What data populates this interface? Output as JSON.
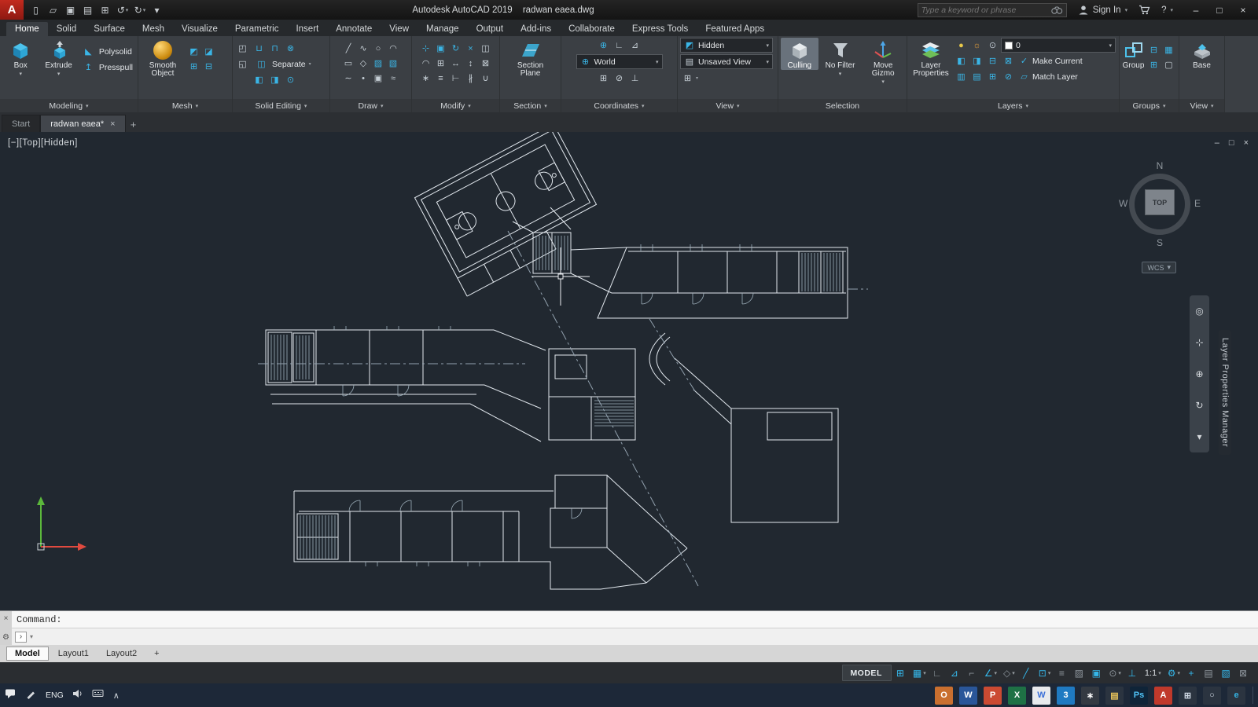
{
  "glyphs": {
    "caret": "▾"
  },
  "titlebar": {
    "logo_letter": "A",
    "app_title": "Autodesk AutoCAD 2019",
    "doc_title": "radwan eaea.dwg",
    "search_placeholder": "Type a keyword or phrase",
    "sign_in_label": "Sign In",
    "help_label": "?",
    "qat": [
      {
        "name": "new-file-icon",
        "text": "▯"
      },
      {
        "name": "open-file-icon",
        "text": "▱"
      },
      {
        "name": "save-icon",
        "text": "▣"
      },
      {
        "name": "save-as-icon",
        "text": "▤"
      },
      {
        "name": "plot-icon",
        "text": "⊞"
      },
      {
        "name": "undo-icon",
        "text": "↺",
        "caret": "▾"
      },
      {
        "name": "redo-icon",
        "text": "↻",
        "caret": "▾"
      },
      {
        "name": "qat-menu-icon",
        "text": "▾"
      }
    ],
    "window_buttons": {
      "minimize": "–",
      "maximize": "□",
      "close": "×"
    }
  },
  "ribbon_tabs": [
    {
      "name": "tab-home",
      "label": "Home",
      "active": true
    },
    {
      "name": "tab-solid",
      "label": "Solid"
    },
    {
      "name": "tab-surface",
      "label": "Surface"
    },
    {
      "name": "tab-mesh",
      "label": "Mesh"
    },
    {
      "name": "tab-visualize",
      "label": "Visualize"
    },
    {
      "name": "tab-parametric",
      "label": "Parametric"
    },
    {
      "name": "tab-insert",
      "label": "Insert"
    },
    {
      "name": "tab-annotate",
      "label": "Annotate"
    },
    {
      "name": "tab-view",
      "label": "View"
    },
    {
      "name": "tab-manage",
      "label": "Manage"
    },
    {
      "name": "tab-output",
      "label": "Output"
    },
    {
      "name": "tab-addins",
      "label": "Add-ins"
    },
    {
      "name": "tab-collaborate",
      "label": "Collaborate"
    },
    {
      "name": "tab-express-tools",
      "label": "Express Tools"
    },
    {
      "name": "tab-featured-apps",
      "label": "Featured Apps"
    }
  ],
  "ribbon_options_icon": "▭",
  "panels": {
    "modeling": {
      "label": "Modeling",
      "caret": "▾",
      "box": "Box",
      "extrude": "Extrude",
      "polysolid": "Polysolid",
      "presspull": "Presspull",
      "polysolid_icon": "◣",
      "presspull_icon": "↥"
    },
    "mesh": {
      "label": "Mesh",
      "caret": "▾",
      "smooth": "Smooth Object",
      "icons": [
        {
          "name": "mesh-revolve-icon",
          "text": "◩",
          "t": true
        },
        {
          "name": "mesh-edge-icon",
          "text": "◪",
          "t": true,
          "caret": "▾"
        },
        {
          "name": "mesh-refine-icon",
          "text": "⊞",
          "t": true
        },
        {
          "name": "mesh-crease-icon",
          "text": "⊟",
          "t": true,
          "caret": "▾"
        }
      ]
    },
    "solid_editing": {
      "label": "Solid Editing",
      "caret": "▾",
      "separate": "Separate",
      "left_icons": [
        {
          "name": "solid-history-icon",
          "text": "◰",
          "caret": "▾"
        },
        {
          "name": "solid-shell-icon",
          "text": "◱",
          "caret": "▾"
        }
      ],
      "row1": [
        {
          "name": "union-icon",
          "text": "⊔",
          "t": true
        },
        {
          "name": "subtract-icon",
          "text": "⊓",
          "t": true
        },
        {
          "name": "intersect-icon",
          "text": "⊗",
          "t": true
        }
      ],
      "separate_icon": "◫",
      "row3": [
        {
          "name": "fillet-edge-icon",
          "text": "◧",
          "t": true,
          "caret": "▾"
        },
        {
          "name": "taper-faces-icon",
          "text": "◨",
          "t": true,
          "caret": "▾"
        },
        {
          "name": "extract-edges-icon",
          "text": "⊙",
          "t": true
        }
      ]
    },
    "draw": {
      "label": "Draw",
      "caret": "▾",
      "icons": [
        {
          "name": "line-icon",
          "text": "╱"
        },
        {
          "name": "polyline-icon",
          "text": "∿"
        },
        {
          "name": "circle-icon",
          "text": "○",
          "caret": "▾"
        },
        {
          "name": "arc-icon",
          "text": "◠",
          "caret": "▾"
        },
        {
          "name": "rectangle-icon",
          "text": "▭",
          "caret": "▾"
        },
        {
          "name": "polygon-icon",
          "text": "◇"
        },
        {
          "name": "hatch-icon",
          "text": "▨",
          "t": true
        },
        {
          "name": "gradient-icon",
          "text": "▧",
          "t": true
        },
        {
          "name": "spline-icon",
          "text": "∼"
        },
        {
          "name": "point-icon",
          "text": "•"
        },
        {
          "name": "region-icon",
          "text": "▣"
        },
        {
          "name": "revision-cloud-icon",
          "text": "≈"
        }
      ]
    },
    "modify": {
      "label": "Modify",
      "caret": "▾",
      "icons": [
        {
          "name": "move-icon",
          "text": "⊹",
          "t": true
        },
        {
          "name": "copy-icon",
          "text": "▣",
          "t": true
        },
        {
          "name": "rotate-icon",
          "text": "↻",
          "t": true
        },
        {
          "name": "trim-icon",
          "text": "×",
          "t": true
        },
        {
          "name": "mirror-icon",
          "text": "◫"
        },
        {
          "name": "fillet-icon",
          "text": "◠",
          "caret": "▾"
        },
        {
          "name": "array-icon",
          "text": "⊞",
          "caret": "▾"
        },
        {
          "name": "stretch-icon",
          "text": "↔"
        },
        {
          "name": "scale-icon",
          "text": "↕"
        },
        {
          "name": "erase-icon",
          "text": "⊠"
        },
        {
          "name": "explode-icon",
          "text": "∗"
        },
        {
          "name": "offset-icon",
          "text": "≡"
        },
        {
          "name": "extend-icon",
          "text": "⊢"
        },
        {
          "name": "break-icon",
          "text": "∦"
        },
        {
          "name": "join-icon",
          "text": "∪"
        }
      ]
    },
    "section": {
      "label": "Section",
      "caret": "▾",
      "plane": "Section Plane"
    },
    "coordinates": {
      "label": "Coordinates",
      "caret": "▾",
      "world": "World",
      "world_icon": "⊕",
      "row1": [
        {
          "name": "ucs-icon",
          "text": "⊕",
          "t": true,
          "caret": "▾"
        },
        {
          "name": "ucs-previous-icon",
          "text": "∟"
        },
        {
          "name": "ucs-face-icon",
          "text": "⊿"
        }
      ],
      "row3": [
        {
          "name": "ucs-origin-icon",
          "text": "⊞"
        },
        {
          "name": "ucs-z-axis-icon",
          "text": "⊘"
        },
        {
          "name": "ucs-view-icon",
          "text": "⊥"
        }
      ]
    },
    "view_styles": {
      "label": "View",
      "caret": "▾",
      "visual_style": "Hidden",
      "visual_style_icon": "◩",
      "named_view": "Unsaved View",
      "named_view_icon": "▤",
      "viewport_icon": "⊞"
    },
    "selection": {
      "label": "Selection",
      "culling": "Culling",
      "no_filter": "No Filter",
      "move_gizmo": "Move Gizmo"
    },
    "layers": {
      "label": "Layers",
      "caret": "▾",
      "properties": "Layer Properties",
      "make_current": "Make Current",
      "match_layer": "Match Layer",
      "current_layer": "0",
      "make_current_icon": "✓",
      "match_layer_icon": "▱",
      "state_icons": [
        {
          "name": "layer-on-icon",
          "text": "●",
          "fg": "#e8c84a"
        },
        {
          "name": "layer-freeze-icon",
          "text": "☼",
          "fg": "#e8a23c"
        },
        {
          "name": "layer-lock-icon",
          "text": "⊙",
          "fg": "#b9c2cb"
        }
      ],
      "row2_icons": [
        {
          "name": "layer-isolate-icon",
          "text": "◧",
          "t": true
        },
        {
          "name": "layer-unisolate-icon",
          "text": "◨",
          "t": true
        },
        {
          "name": "layer-freeze-pick-icon",
          "text": "⊟",
          "t": true
        },
        {
          "name": "layer-off-pick-icon",
          "text": "⊠",
          "t": true
        }
      ],
      "row3_icons": [
        {
          "name": "layer-walk-icon",
          "text": "▥",
          "t": true
        },
        {
          "name": "layer-states-icon",
          "text": "▤",
          "t": true
        },
        {
          "name": "layer-merge-icon",
          "text": "⊞",
          "t": true
        },
        {
          "name": "layer-delete-icon",
          "text": "⊘",
          "t": true
        }
      ]
    },
    "groups": {
      "label": "Groups",
      "caret": "▾",
      "group": "Group",
      "icons": [
        {
          "name": "ungroup-icon",
          "text": "⊟",
          "t": true
        },
        {
          "name": "group-edit-icon",
          "text": "▦",
          "t": true
        },
        {
          "name": "group-selection-icon",
          "text": "⊞",
          "t": true
        },
        {
          "name": "group-bbox-icon",
          "text": "▢"
        }
      ]
    },
    "view_create": {
      "label": "View",
      "caret": "▾",
      "base": "Base"
    }
  },
  "file_tabs": {
    "start": "Start",
    "drawing": "radwan eaea*",
    "close_icon": "×",
    "new_tab": "+"
  },
  "viewport": {
    "controls": {
      "minimize": "[−]",
      "view": "[Top]",
      "visual_style": "[Hidden]"
    },
    "window_buttons": {
      "minimize": "–",
      "restore": "□",
      "close": "×"
    },
    "viewcube": {
      "n": "N",
      "e": "E",
      "s": "S",
      "w": "W",
      "face": "TOP",
      "wcs": "WCS",
      "wcs_caret": "▾"
    },
    "navbar_icons": [
      {
        "name": "steering-wheel-icon",
        "text": "◎"
      },
      {
        "name": "pan-icon",
        "text": "⊹"
      },
      {
        "name": "zoom-icon",
        "text": "⊕"
      },
      {
        "name": "orbit-icon",
        "text": "↻"
      },
      {
        "name": "navbar-more-icon",
        "text": "▾"
      }
    ],
    "palette_title": "Layer Properties Manager"
  },
  "command": {
    "prompt": "Command:",
    "close_icon": "×",
    "customize_icon": "⚙",
    "recent_icon": "›",
    "caret_icon": "▾"
  },
  "layout_tabs": [
    {
      "name": "layout-tab-model",
      "label": "Model",
      "active": true
    },
    {
      "name": "layout-tab-layout1",
      "label": "Layout1"
    },
    {
      "name": "layout-tab-layout2",
      "label": "Layout2"
    },
    {
      "name": "new-layout-button",
      "label": "+"
    }
  ],
  "statusbar": [
    {
      "name": "model-space-toggle",
      "text": "MODEL",
      "wide": true
    },
    {
      "name": "grid-display-icon",
      "text": "⊞",
      "on": true
    },
    {
      "name": "snap-mode-icon",
      "text": "▦",
      "on": true,
      "caret": "▾"
    },
    {
      "name": "infer-constraints-icon",
      "text": "∟"
    },
    {
      "name": "dynamic-input-icon",
      "text": "⊿",
      "on": true
    },
    {
      "name": "ortho-mode-icon",
      "text": "⌐"
    },
    {
      "name": "polar-tracking-icon",
      "text": "∠",
      "on": true,
      "caret": "▾"
    },
    {
      "name": "isometric-drafting-icon",
      "text": "◇",
      "caret": "▾"
    },
    {
      "name": "osnap-tracking-icon",
      "text": "╱",
      "on": true
    },
    {
      "name": "object-snap-icon",
      "text": "⊡",
      "on": true,
      "caret": "▾"
    },
    {
      "name": "lineweight-icon",
      "text": "≡"
    },
    {
      "name": "transparency-icon",
      "text": "▨"
    },
    {
      "name": "selection-cycling-icon",
      "text": "▣",
      "on": true
    },
    {
      "name": "3d-object-snap-icon",
      "text": "⊙",
      "caret": "▾"
    },
    {
      "name": "dynamic-ucs-icon",
      "text": "⊥",
      "on": true
    },
    {
      "name": "annotation-scale",
      "text": "1:1",
      "caret": "▾"
    },
    {
      "name": "workspace-switching-icon",
      "text": "⚙",
      "on": true,
      "caret": "▾"
    },
    {
      "name": "annotation-monitor-icon",
      "text": "+",
      "on": true
    },
    {
      "name": "quick-properties-icon",
      "text": "▤"
    },
    {
      "name": "graphics-performance-icon",
      "text": "▧",
      "on": true
    },
    {
      "name": "clean-screen-icon",
      "text": "⊠"
    }
  ],
  "taskbar": {
    "language": "ENG",
    "chevron": "∧",
    "apps": [
      {
        "name": "taskbar-outlook",
        "text": "O",
        "bg": "#c96f2f"
      },
      {
        "name": "taskbar-word",
        "text": "W",
        "bg": "#2a5699"
      },
      {
        "name": "taskbar-powerpoint",
        "text": "P",
        "bg": "#cb4a32"
      },
      {
        "name": "taskbar-excel",
        "text": "X",
        "bg": "#1e7145"
      },
      {
        "name": "taskbar-wps",
        "text": "W",
        "bg": "#e8eaed",
        "fg": "#3a6fd8"
      },
      {
        "name": "taskbar-3dsmax",
        "text": "3",
        "bg": "#1f7ac2"
      },
      {
        "name": "taskbar-snip",
        "text": "∗",
        "bg": "#343a42"
      },
      {
        "name": "taskbar-explorer",
        "text": "▤",
        "bg": "#2b3440",
        "fg": "#e8c35a"
      },
      {
        "name": "taskbar-photoshop",
        "text": "Ps",
        "bg": "#0f2438",
        "fg": "#4fc3f7"
      },
      {
        "name": "taskbar-autocad",
        "text": "A",
        "bg": "#c0392b"
      },
      {
        "name": "taskbar-taskview",
        "text": "⊞",
        "bg": "#2b3440",
        "fg": "#cfd8e3"
      },
      {
        "name": "taskbar-search",
        "text": "○",
        "bg": "#2b3440",
        "fg": "#cfd8e3"
      },
      {
        "name": "taskbar-edge",
        "text": "e",
        "bg": "#2b3440",
        "fg": "#35b3e3"
      }
    ]
  }
}
